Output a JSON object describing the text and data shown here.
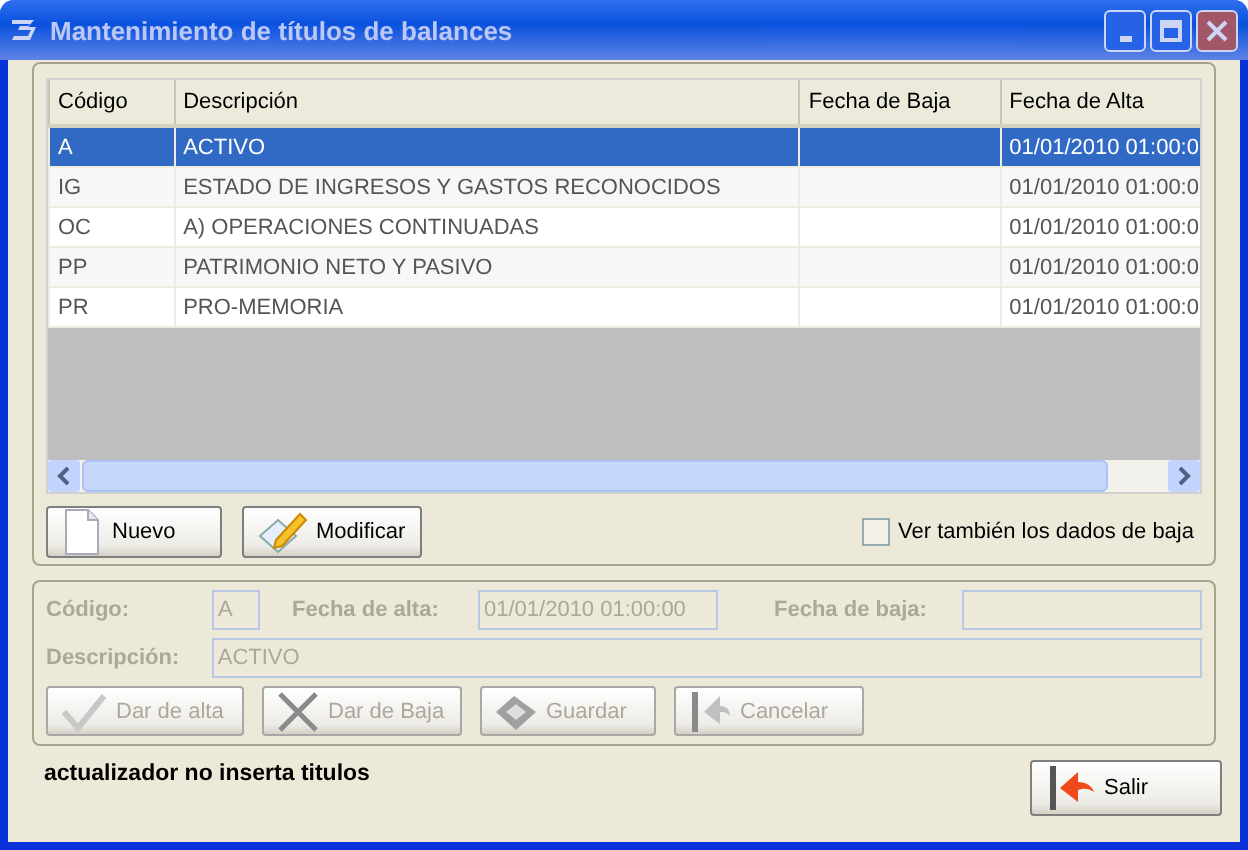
{
  "window": {
    "title": "Mantenimiento de títulos de balances"
  },
  "table": {
    "columns": [
      "Código",
      "Descripción",
      "Fecha de Baja",
      "Fecha de Alta"
    ],
    "rows": [
      {
        "cells": [
          "A",
          "ACTIVO",
          "",
          "01/01/2010 01:00:0"
        ],
        "selected": true
      },
      {
        "cells": [
          "IG",
          "ESTADO DE INGRESOS Y GASTOS RECONOCIDOS",
          "",
          "01/01/2010 01:00:0"
        ],
        "selected": false
      },
      {
        "cells": [
          "OC",
          "A) OPERACIONES CONTINUADAS",
          "",
          "01/01/2010 01:00:0"
        ],
        "selected": false
      },
      {
        "cells": [
          "PP",
          "PATRIMONIO NETO Y PASIVO",
          "",
          "01/01/2010 01:00:0"
        ],
        "selected": false
      },
      {
        "cells": [
          "PR",
          "PRO-MEMORIA",
          "",
          "01/01/2010 01:00:0"
        ],
        "selected": false
      }
    ]
  },
  "list_buttons": [
    {
      "label": "Nuevo",
      "kind": "new"
    },
    {
      "label": "Modificar",
      "kind": "edit"
    }
  ],
  "show_deleted": {
    "label": "Ver también los dados de baja",
    "checked": false
  },
  "form": {
    "disabled": true,
    "fields": [
      {
        "label": "Código:",
        "value": "A"
      },
      {
        "label": "Fecha de alta:",
        "value": "01/01/2010 01:00:00"
      },
      {
        "label": "Fecha de baja:"
      },
      {
        "label": "Descripción:",
        "value": "ACTIVO"
      }
    ],
    "buttons": [
      {
        "label": "Dar de alta",
        "kind": "check",
        "disabled": true
      },
      {
        "label": "Dar de Baja",
        "kind": "cross",
        "disabled": true
      },
      {
        "label": "Guardar",
        "kind": "save",
        "disabled": true
      },
      {
        "label": "Cancelar",
        "kind": "cancel",
        "disabled": true
      }
    ]
  },
  "status": "actualizador no inserta titulos",
  "exit_button": {
    "label": "Salir"
  }
}
